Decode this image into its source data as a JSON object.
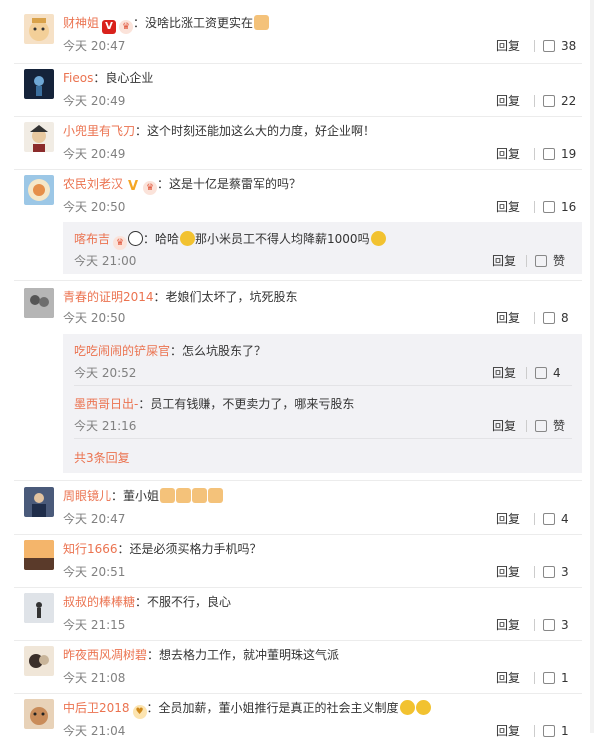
{
  "actions": {
    "reply": "回复",
    "like": "赞"
  },
  "comments": [
    {
      "user": "财神姐",
      "text": "：没啥比涨工资更实在",
      "time": "今天 20:47",
      "likes": "38"
    },
    {
      "user": "Fieos",
      "text": "：良心企业",
      "time": "今天 20:49",
      "likes": "22"
    },
    {
      "user": "小兜里有飞刀",
      "text": "：这个时刻还能加这么大的力度，好企业啊！",
      "time": "今天 20:49",
      "likes": "19"
    },
    {
      "user": "农民刘老汉",
      "text": "：这是十亿是蔡雷军的吗？",
      "time": "今天 20:50",
      "likes": "16"
    },
    {
      "user": "青春的证明2014",
      "text": "：老娘们太坏了，坑死股东",
      "time": "今天 20:50",
      "likes": "8"
    },
    {
      "user": "周眼镜儿",
      "text": "：董小姐",
      "time": "今天 20:47",
      "likes": "4"
    },
    {
      "user": "知行1666",
      "text": "：还是必须买格力手机吗？",
      "time": "今天 20:51",
      "likes": "3"
    },
    {
      "user": "叔叔的棒棒糖",
      "text": "：不服不行，良心",
      "time": "今天 21:15",
      "likes": "3"
    },
    {
      "user": "昨夜西风凋树碧",
      "text": "：想去格力工作，就冲董明珠这气派",
      "time": "今天 21:08",
      "likes": "1"
    },
    {
      "user": "中后卫2018",
      "text": "：全员加薪，董小姐推行是真正的社会主义制度",
      "time": "今天 21:04",
      "likes": "1"
    }
  ],
  "replies": {
    "c4": [
      {
        "user": "喀布吉",
        "text": "：哈哈",
        "text2": "那小米员工不得人均降薪1000吗",
        "time": "今天 21:00",
        "likes": "赞"
      }
    ],
    "c5": [
      {
        "user": "吃吃闹闹的铲屎官",
        "text": "：怎么坑股东了？",
        "time": "今天 20:52",
        "likes": "4"
      },
      {
        "user": "墨西哥日出-",
        "text": "：员工有钱赚，不更卖力了，哪来亏股东",
        "time": "今天 21:16",
        "likes": "赞"
      }
    ],
    "c5_more": "共3条回复"
  },
  "colors": {
    "username": "#eb7350",
    "muted": "#808080",
    "reply_bg": "#f2f2f5"
  }
}
